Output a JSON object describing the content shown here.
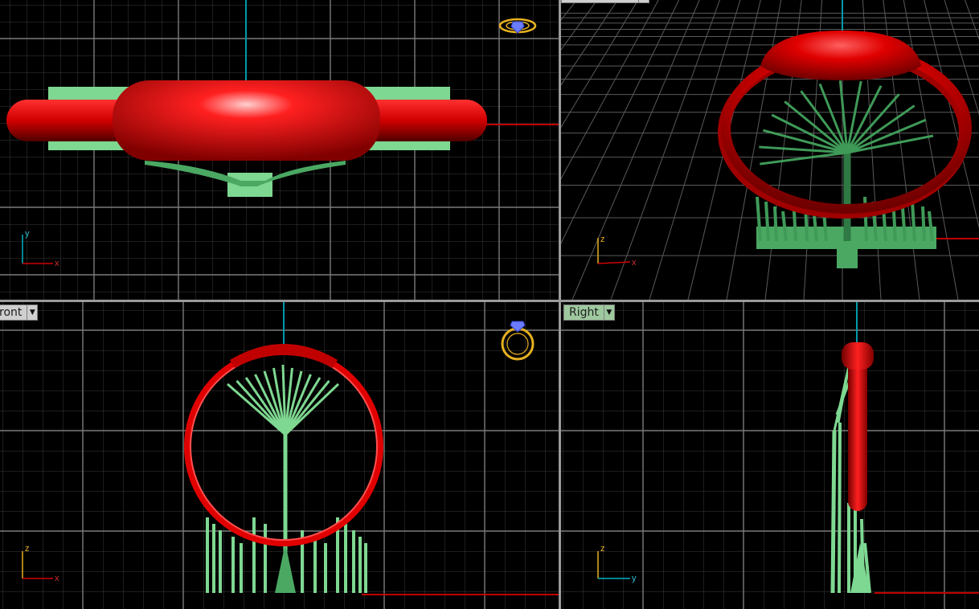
{
  "viewports": {
    "top": {
      "title": ""
    },
    "perspective": {
      "title": ""
    },
    "front": {
      "title": "ront"
    },
    "right": {
      "title": "Right"
    }
  },
  "axes": {
    "top": [
      "x",
      "y"
    ],
    "perspective": [
      "x",
      "z"
    ],
    "front": [
      "x",
      "z"
    ],
    "right": [
      "y",
      "z"
    ]
  },
  "colors": {
    "background": "#000000",
    "grid_minor": "#3a3a3a",
    "grid_major": "#7a7a7a",
    "ring": "#e00000",
    "supports": "#7ed891",
    "x_axis": "#c00000",
    "y_axis": "#0099aa",
    "gizmo": "#e6b020"
  },
  "icons": {
    "top_gizmo": "ring-top-view-icon",
    "front_gizmo": "ring-front-view-icon",
    "dropdown": "dropdown-arrow-icon"
  }
}
